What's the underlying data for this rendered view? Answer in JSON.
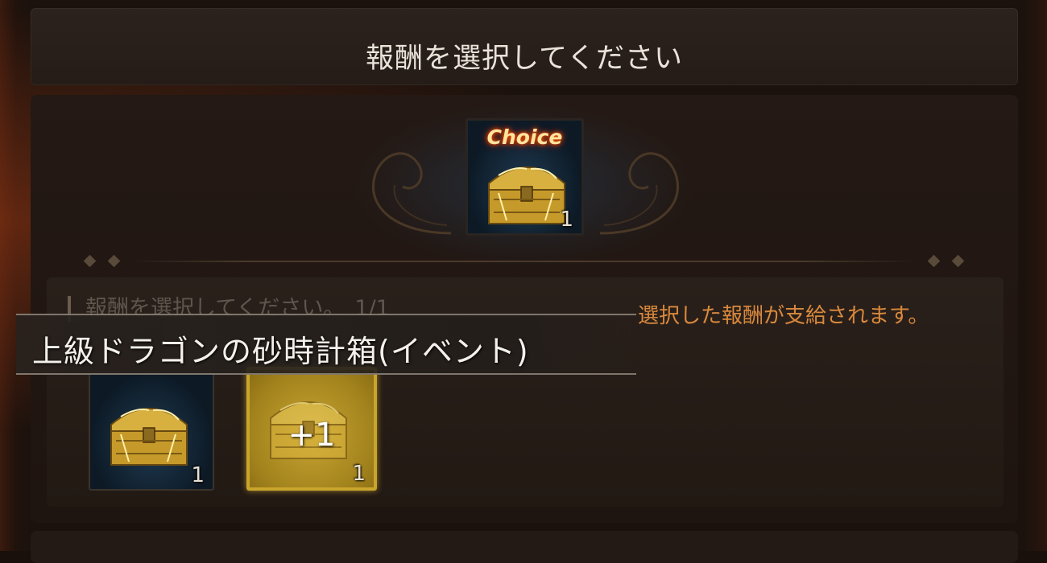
{
  "header": {
    "title": "報酬を選択してください"
  },
  "choice_item": {
    "badge": "Choice",
    "count": "1",
    "icon": "treasure-chest-icon"
  },
  "selection": {
    "label": "報酬を選択してください。",
    "counter": "1/1",
    "note": "選択した報酬が支給されます。"
  },
  "tooltip": {
    "item_name": "上級ドラゴンの砂時計箱(イベント)"
  },
  "slots": [
    {
      "icon": "treasure-chest-icon",
      "count": "1",
      "selected": false
    },
    {
      "icon": "treasure-chest-icon",
      "count": "1",
      "selected": true,
      "overlay": "+1"
    }
  ],
  "colors": {
    "note_text": "#d9893c",
    "selected_border": "#c9a52c",
    "background": "#1a100b"
  }
}
